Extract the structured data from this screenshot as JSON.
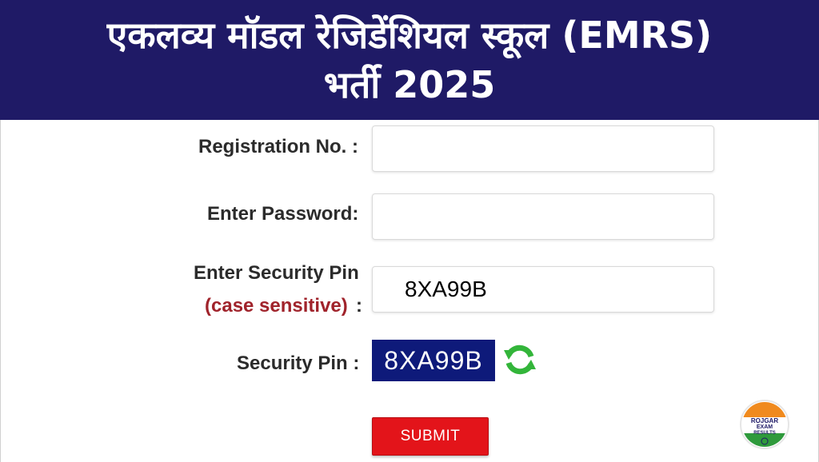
{
  "banner": {
    "line1": "एकलव्य मॉडल रेजिडेंशियल स्कूल (EMRS)",
    "line2": "भर्ती 2025"
  },
  "form": {
    "registration_label": "Registration No. :",
    "password_label": "Enter Password:",
    "security_pin_entry_label": "Enter Security Pin",
    "case_sensitive_label": "(case sensitive)",
    "case_sensitive_colon": ":",
    "security_pin_entry_value": "8XA99B",
    "security_pin_label": "Security Pin :",
    "captcha_text": "8XA99B",
    "submit_label": "SUBMIT"
  },
  "logo": {
    "text_line1": "ROJGAR",
    "text_line2": "EXAM",
    "text_line3": "RESULTS"
  },
  "colors": {
    "banner_bg": "#1f1a66",
    "captcha_bg": "#0e1a7a",
    "submit_bg": "#e3141a",
    "case_sensitive": "#a0232b",
    "refresh_green": "#33b53a"
  },
  "icons": {
    "refresh": "refresh-icon"
  }
}
